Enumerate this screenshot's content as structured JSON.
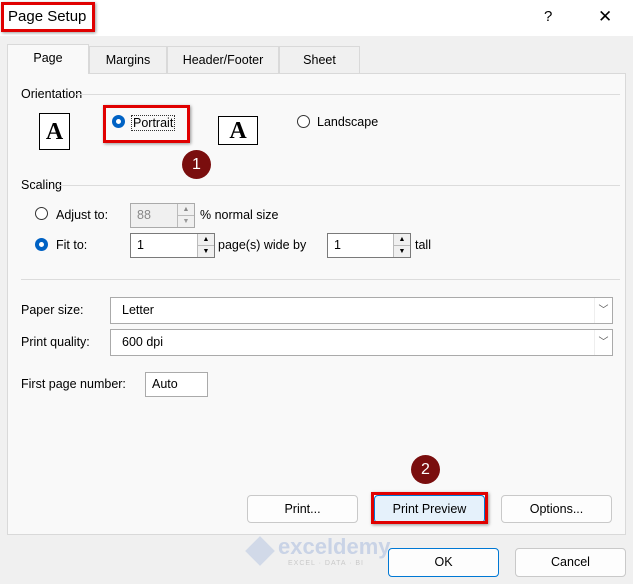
{
  "window": {
    "title": "Page Setup",
    "help": "?",
    "close": "✕"
  },
  "tabs": [
    {
      "label": "Page"
    },
    {
      "label": "Margins"
    },
    {
      "label": "Header/Footer"
    },
    {
      "label": "Sheet"
    }
  ],
  "orientation": {
    "label": "Orientation",
    "portrait": "Portrait",
    "landscape": "Landscape",
    "icon_glyph": "A",
    "selected": "portrait"
  },
  "scaling": {
    "label": "Scaling",
    "adjust_to": "Adjust to:",
    "adjust_value": "88",
    "normal_size": "% normal size",
    "fit_to": "Fit to:",
    "wide_value": "1",
    "wide_label": "page(s) wide by",
    "tall_value": "1",
    "tall_label": "tall"
  },
  "paper_size": {
    "label": "Paper size:",
    "value": "Letter"
  },
  "print_quality": {
    "label": "Print quality:",
    "value": "600 dpi"
  },
  "first_page": {
    "label": "First page number:",
    "value": "Auto"
  },
  "buttons": {
    "print": "Print...",
    "print_preview": "Print Preview",
    "options": "Options...",
    "ok": "OK",
    "cancel": "Cancel"
  },
  "badges": [
    "1",
    "2"
  ],
  "watermark": {
    "name": "exceldemy",
    "tagline": "EXCEL · DATA · BI"
  },
  "colors": {
    "accent": "#0062c4",
    "highlight": "#e00000",
    "badge": "#7a0e0e"
  }
}
